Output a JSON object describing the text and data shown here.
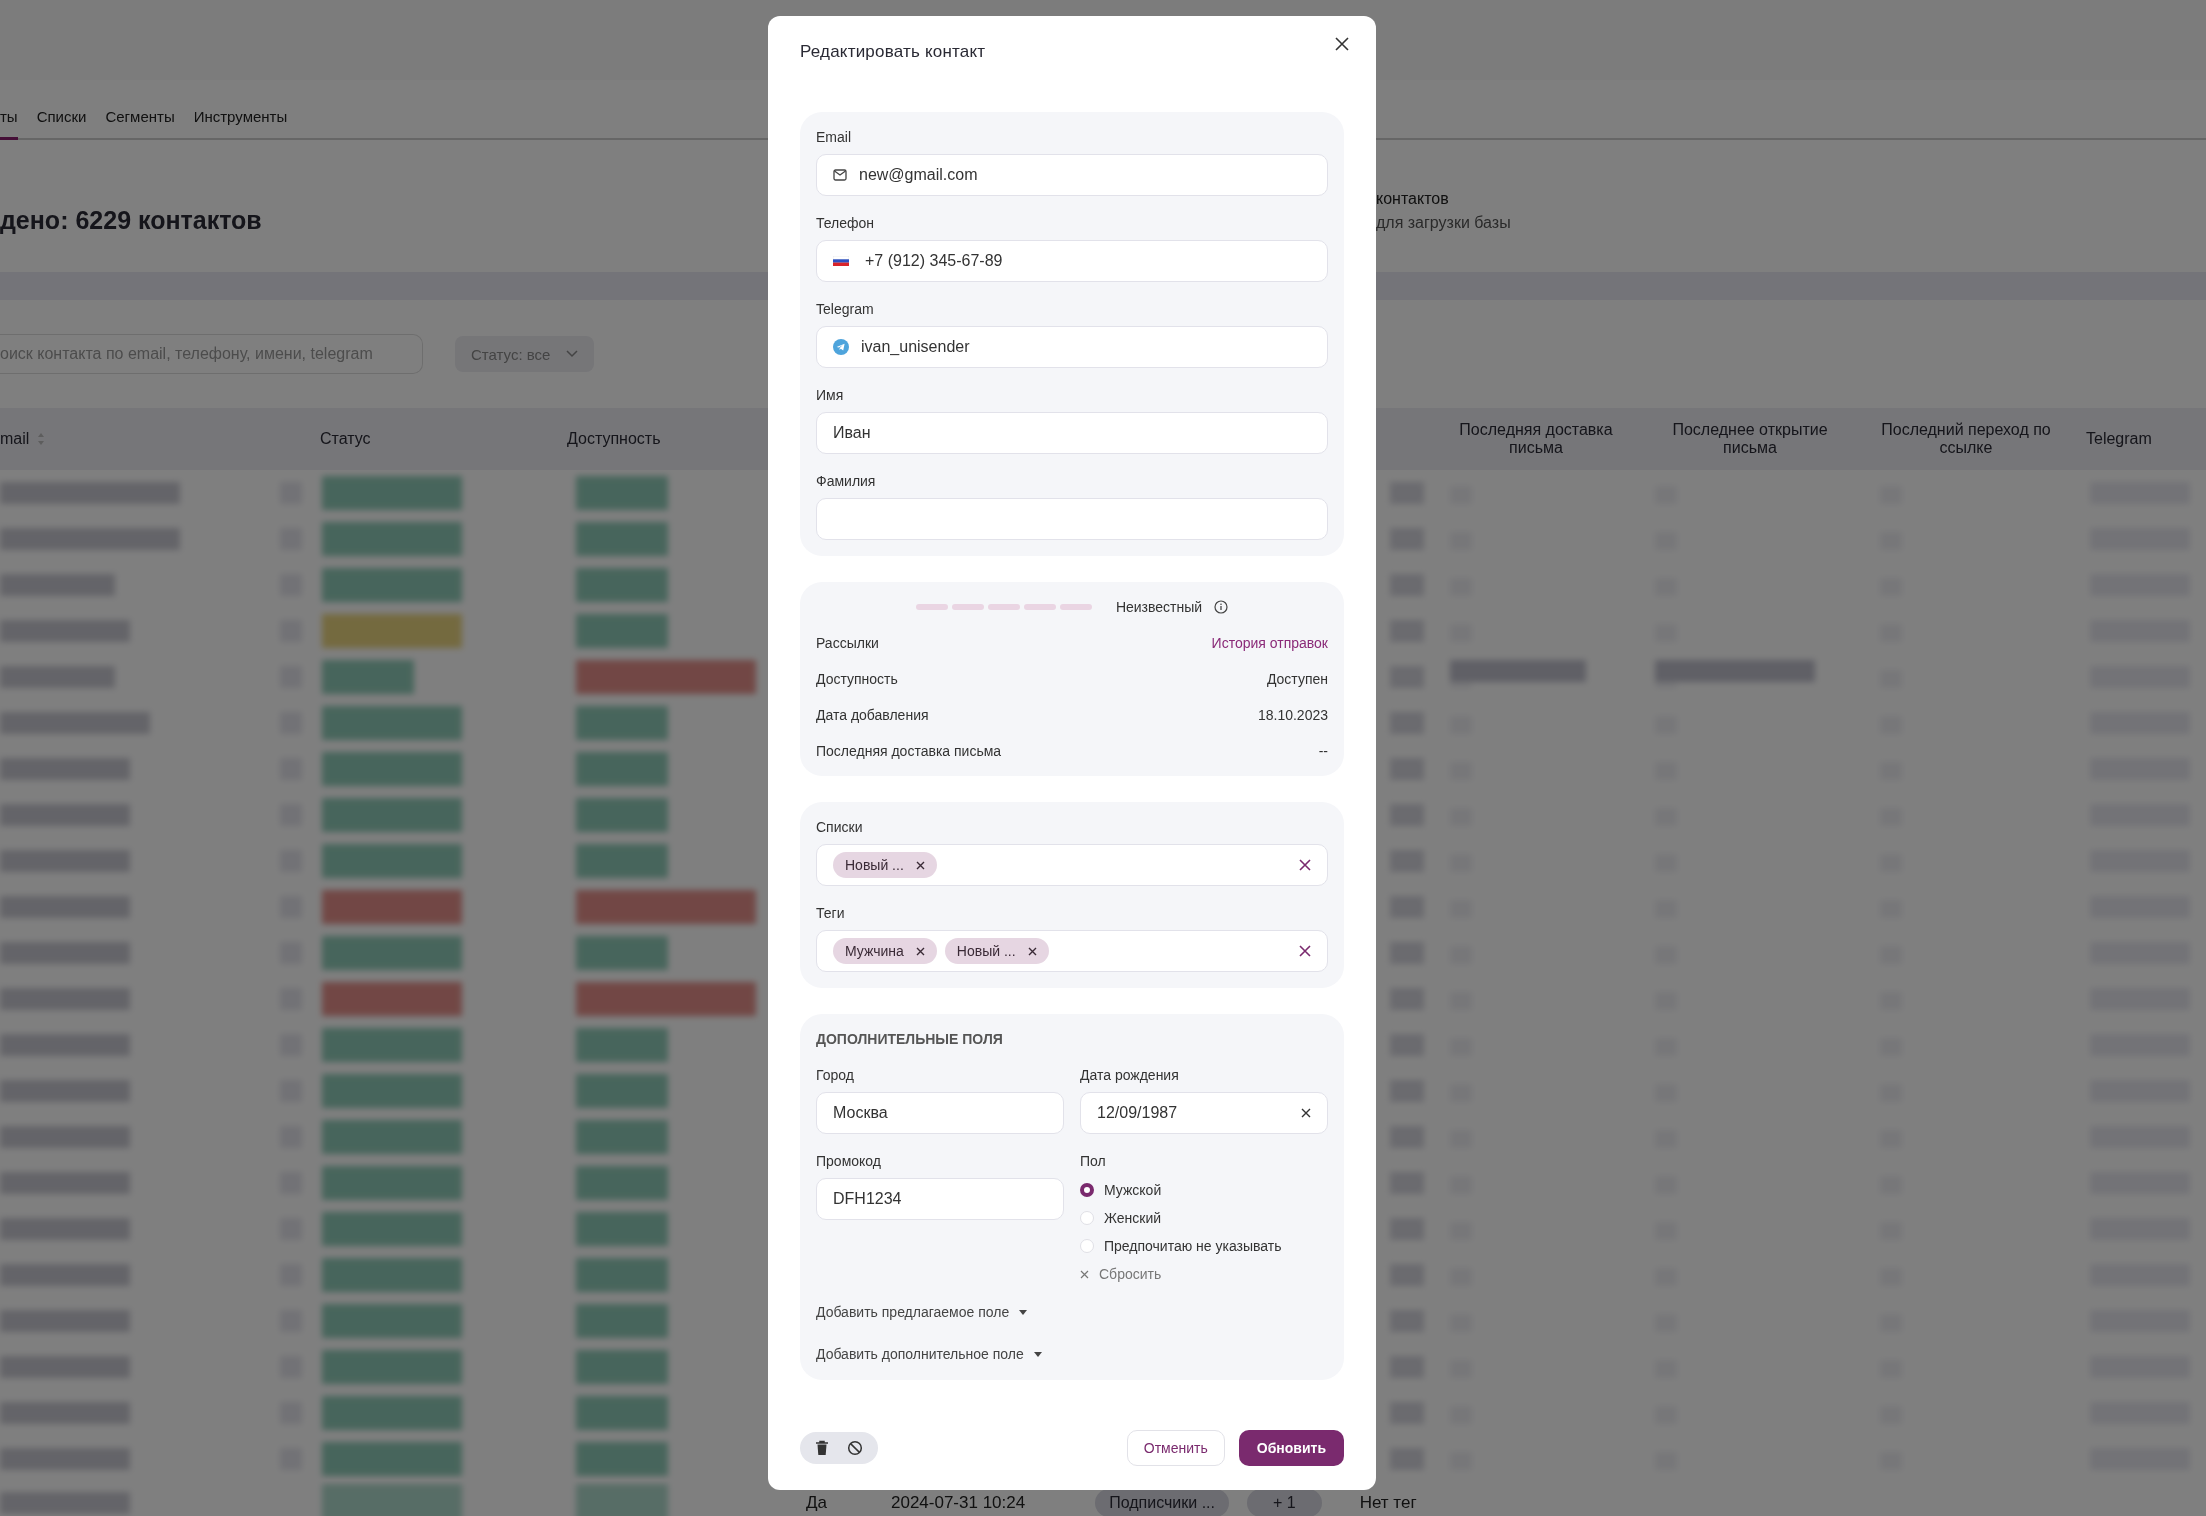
{
  "page": {
    "tabs": [
      {
        "label": "ты",
        "selected": true
      },
      {
        "label": "Списки",
        "selected": false
      },
      {
        "label": "Сегменты",
        "selected": false
      },
      {
        "label": "Инструменты",
        "selected": false
      }
    ],
    "heading": "дено: 6229 контактов",
    "import_hint": {
      "title": "контактов",
      "subtitle": "для загрузки базы"
    },
    "search": {
      "placeholder": "оиск контакта по email, телефону, имени, telegram"
    },
    "status_filter": "Статус: все",
    "table": {
      "columns": [
        "mail",
        "Статус",
        "Доступность",
        "Последняя доставка письма",
        "Последнее открытие письма",
        "Последний переход по ссылке",
        "Telegram"
      ],
      "last_row": {
        "available": "Да",
        "date": "2024-07-31 10:24",
        "list": "Подписчики ...",
        "more": "+ 1",
        "tags": "Нет тег"
      }
    }
  },
  "dialog": {
    "title": "Редактировать контакт",
    "contact_fields": [
      {
        "label": "Email",
        "value": "new@gmail.com",
        "kind": "email"
      },
      {
        "label": "Телефон",
        "value": "+7 (912) 345-67-89",
        "kind": "phone"
      },
      {
        "label": "Telegram",
        "value": "ivan_unisender",
        "kind": "telegram"
      },
      {
        "label": "Имя",
        "value": "Иван",
        "kind": "text"
      },
      {
        "label": "Фамилия",
        "kind": "text"
      }
    ],
    "rating": {
      "label": "Неизвестный"
    },
    "info_rows": [
      {
        "label": "Рассылки",
        "value": "История отправок",
        "kind": "link"
      },
      {
        "label": "Доступность",
        "value": "Доступен",
        "kind": "text"
      },
      {
        "label": "Дата добавления",
        "value": "18.10.2023",
        "kind": "text"
      },
      {
        "label": "Последняя доставка письма",
        "value": "--",
        "kind": "text"
      }
    ],
    "chip_fields": [
      {
        "label": "Списки",
        "chips": [
          "Новый ..."
        ]
      },
      {
        "label": "Теги",
        "chips": [
          "Мужчина",
          "Новый ..."
        ]
      }
    ],
    "extra": {
      "title": "ДОПОЛНИТЕЛЬНЫЕ ПОЛЯ",
      "city": {
        "label": "Город",
        "value": "Москва"
      },
      "birthday": {
        "label": "Дата рождения",
        "value": "12/09/1987"
      },
      "promo": {
        "label": "Промокод",
        "value": "DFH1234"
      },
      "gender": {
        "label": "Пол",
        "options": [
          {
            "label": "Мужской",
            "selected": true
          },
          {
            "label": "Женский",
            "selected": false
          },
          {
            "label": "Предпочитаю не указывать",
            "selected": false
          }
        ],
        "reset": "Сбросить"
      },
      "add_links": [
        "Добавить предлагаемое поле",
        "Добавить дополнительное поле"
      ]
    },
    "buttons": {
      "cancel": "Отменить",
      "submit": "Обновить"
    }
  }
}
